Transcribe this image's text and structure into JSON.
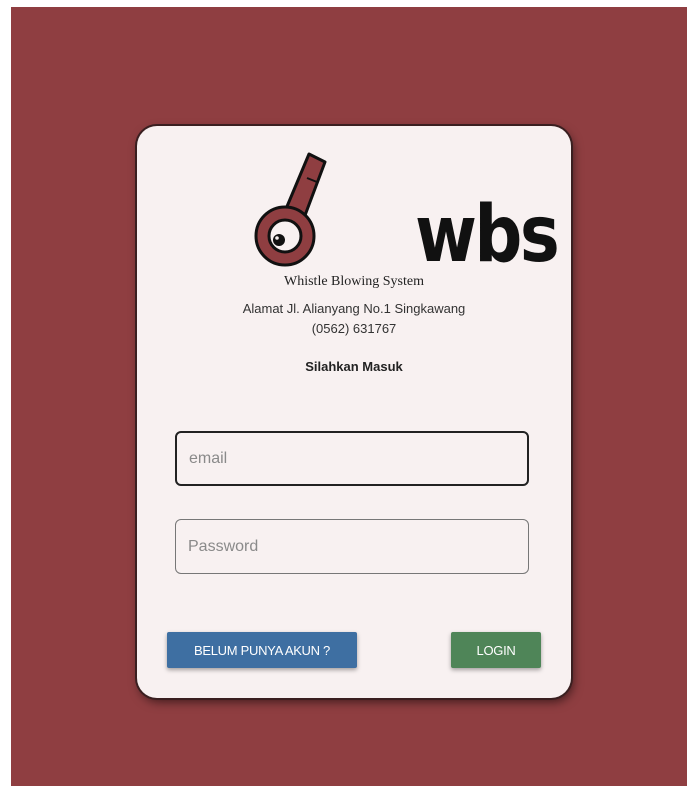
{
  "logo": {
    "text": "wbs",
    "icon": "whistle-icon"
  },
  "system_name": "Whistle Blowing System",
  "address": "Alamat Jl. Alianyang No.1 Singkawang",
  "phone": "(0562) 631767",
  "prompt": "Silahkan Masuk",
  "form": {
    "email_placeholder": "email",
    "email_value": "",
    "password_placeholder": "Password",
    "password_value": ""
  },
  "buttons": {
    "register_label": "BELUM PUNYA AKUN ?",
    "login_label": "LOGIN"
  },
  "colors": {
    "background": "#8f3e41",
    "card": "#f8f1f1",
    "register_button": "#3e6fa2",
    "login_button": "#4f8558",
    "whistle": "#8f3e41"
  }
}
